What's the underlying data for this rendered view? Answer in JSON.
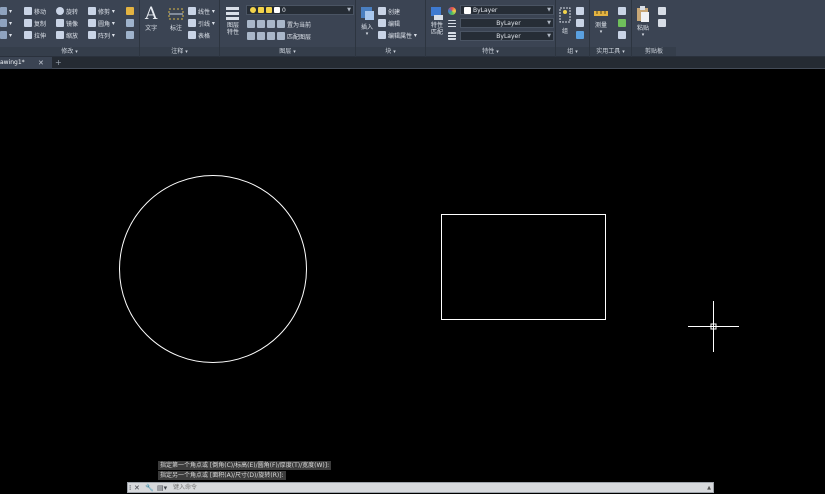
{
  "ribbon": {
    "modify": {
      "title": "修改",
      "col1": [
        "移动",
        "复制",
        "拉伸"
      ],
      "col2": [
        "旋转",
        "镜像",
        "缩放"
      ],
      "col3": [
        "修剪",
        "圆角",
        "阵列"
      ]
    },
    "annotation": {
      "title": "注释",
      "text_label": "文字",
      "dim_label": "标注",
      "items": [
        "线性",
        "引线",
        "表格"
      ]
    },
    "layers": {
      "title": "图层",
      "layer_props_label": "图层特性",
      "current_layer": "0",
      "items": [
        "置为当前",
        "匹配图层"
      ]
    },
    "block": {
      "title": "块",
      "insert_label": "插入",
      "items": [
        "创建",
        "编辑",
        "编辑属性"
      ]
    },
    "properties": {
      "title": "特性",
      "match_label": "特性匹配",
      "color": "ByLayer",
      "linetype": "ByLayer",
      "lineweight": "ByLayer"
    },
    "groups": {
      "title": "组",
      "group_label": "组"
    },
    "utilities": {
      "title": "实用工具",
      "measure_label": "测量"
    },
    "clipboard": {
      "title": "剪贴板",
      "paste_label": "粘贴"
    }
  },
  "tabs": {
    "drawing_tab": "awing1*",
    "close_glyph": "✕",
    "add_glyph": "+"
  },
  "command": {
    "history": [
      "指定第一个角点或 [倒角(C)/标高(E)/圆角(F)/厚度(T)/宽度(W)]:",
      "指定另一个角点或 [面积(A)/尺寸(D)/旋转(R)]:"
    ],
    "placeholder": "键入命令"
  },
  "colors": {
    "ribbon_bg": "#3b4453",
    "canvas_bg": "#000000",
    "entity": "#ffffff",
    "command_bar": "#d7d9dc"
  }
}
